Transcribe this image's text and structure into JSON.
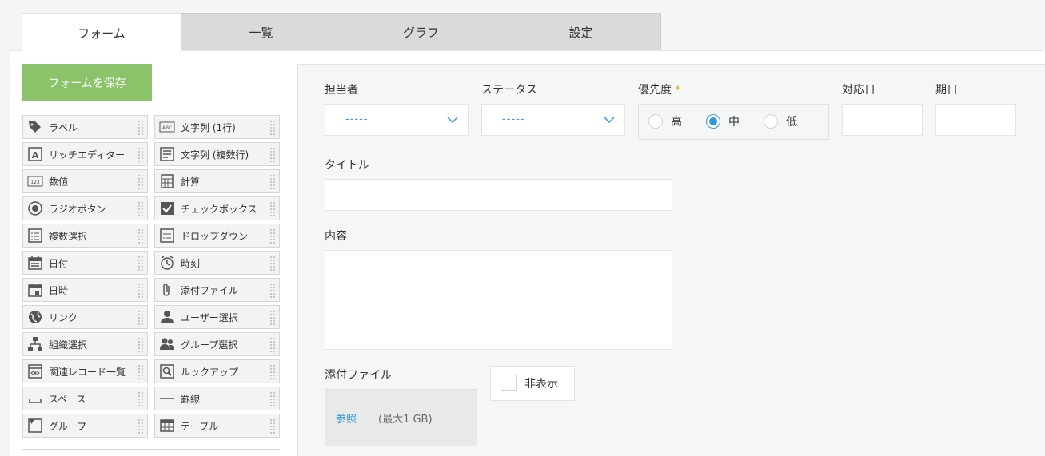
{
  "tabs": [
    {
      "label": "フォーム",
      "active": true
    },
    {
      "label": "一覧",
      "active": false
    },
    {
      "label": "グラフ",
      "active": false
    },
    {
      "label": "設定",
      "active": false
    }
  ],
  "toolbar": {
    "save_label": "フォームを保存"
  },
  "palette": [
    {
      "label": "ラベル",
      "icon": "tag-icon"
    },
    {
      "label": "文字列 (1行)",
      "icon": "abc-icon"
    },
    {
      "label": "リッチエディター",
      "icon": "rich-text-icon"
    },
    {
      "label": "文字列 (複数行)",
      "icon": "multiline-text-icon"
    },
    {
      "label": "数値",
      "icon": "number-icon"
    },
    {
      "label": "計算",
      "icon": "calculator-icon"
    },
    {
      "label": "ラジオボタン",
      "icon": "radio-icon"
    },
    {
      "label": "チェックボックス",
      "icon": "checkbox-icon"
    },
    {
      "label": "複数選択",
      "icon": "multi-select-icon"
    },
    {
      "label": "ドロップダウン",
      "icon": "dropdown-icon"
    },
    {
      "label": "日付",
      "icon": "calendar-icon"
    },
    {
      "label": "時刻",
      "icon": "alarm-clock-icon"
    },
    {
      "label": "日時",
      "icon": "datetime-icon"
    },
    {
      "label": "添付ファイル",
      "icon": "paperclip-icon"
    },
    {
      "label": "リンク",
      "icon": "globe-icon"
    },
    {
      "label": "ユーザー選択",
      "icon": "user-icon"
    },
    {
      "label": "組織選択",
      "icon": "org-chart-icon"
    },
    {
      "label": "グループ選択",
      "icon": "group-users-icon"
    },
    {
      "label": "関連レコード一覧",
      "icon": "related-records-icon"
    },
    {
      "label": "ルックアップ",
      "icon": "lookup-icon"
    },
    {
      "label": "スペース",
      "icon": "space-icon"
    },
    {
      "label": "罫線",
      "icon": "line-icon"
    },
    {
      "label": "グループ",
      "icon": "group-box-icon"
    },
    {
      "label": "テーブル",
      "icon": "table-icon"
    }
  ],
  "form": {
    "assignee": {
      "label": "担当者",
      "value": "-----"
    },
    "status": {
      "label": "ステータス",
      "value": "-----"
    },
    "priority": {
      "label": "優先度",
      "required_mark": "*",
      "options": [
        {
          "label": "高",
          "selected": false
        },
        {
          "label": "中",
          "selected": true
        },
        {
          "label": "低",
          "selected": false
        }
      ]
    },
    "response_date": {
      "label": "対応日"
    },
    "due_date": {
      "label": "期日"
    },
    "title": {
      "label": "タイトル",
      "value": ""
    },
    "content": {
      "label": "内容",
      "value": ""
    },
    "attachment": {
      "label": "添付ファイル",
      "browse": "参照",
      "max_size": "(最大1 GB)"
    },
    "hide": {
      "label": "非表示",
      "checked": false
    }
  },
  "colors": {
    "accent": "#3498db",
    "save_button": "#8bc36a",
    "required": "#e0a53b"
  }
}
